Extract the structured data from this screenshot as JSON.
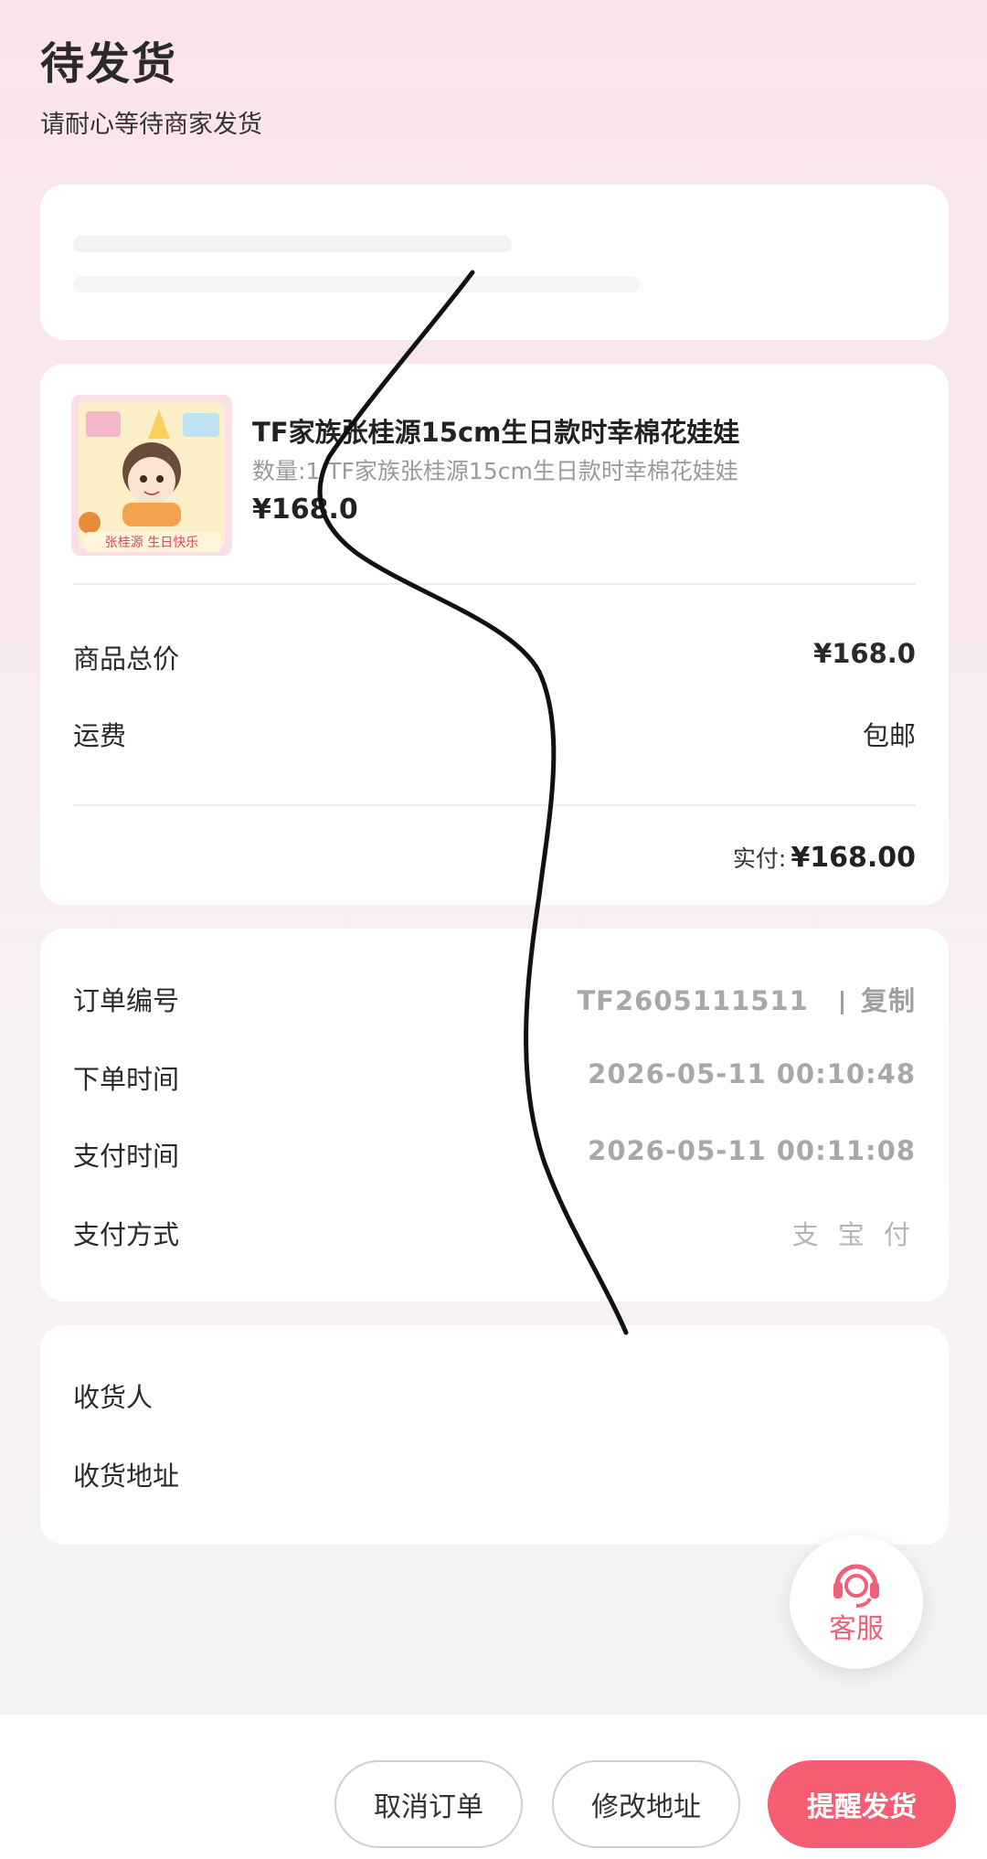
{
  "status": {
    "title": "待发货",
    "subtitle": "请耐心等待商家发货"
  },
  "product": {
    "title": "TF家族张桂源15cm生日款时幸棉花娃娃",
    "spec": "数量:1 TF家族张桂源15cm生日款时幸棉花娃娃",
    "price": "¥168.0",
    "image_text": "张桂源 生日快乐"
  },
  "summary": {
    "total_label": "商品总价",
    "total_value": "¥168.0",
    "shipping_label": "运费",
    "shipping_value": "包邮",
    "paid_label": "实付:",
    "paid_value": "¥168.00"
  },
  "order": {
    "number_label": "订单编号",
    "number_value": "TF2605111511",
    "copy_label": "复制",
    "created_label": "下单时间",
    "created_value": "2026-05-11 00:10:48",
    "paid_time_label": "支付时间",
    "paid_time_value": "2026-05-11 00:11:08",
    "payment_method_label": "支付方式",
    "payment_method_value": "支 宝 付"
  },
  "receiver": {
    "name_label": "收货人",
    "address_label": "收货地址"
  },
  "customer_service": {
    "label": "客服",
    "icon": "headset-icon"
  },
  "actions": {
    "cancel": "取消订单",
    "modify_address": "修改地址",
    "remind": "提醒发货"
  },
  "colors": {
    "accent": "#f45d72",
    "background": "#fbe4ee"
  }
}
